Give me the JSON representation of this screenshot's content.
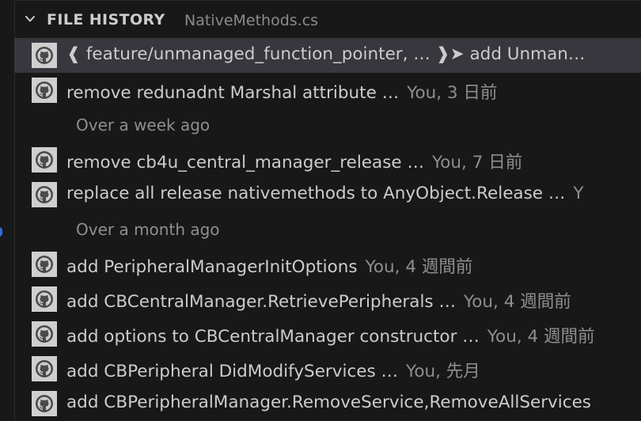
{
  "header": {
    "title": "FILE HISTORY",
    "file": "NativeMethods.cs"
  },
  "rows": [
    {
      "kind": "commit",
      "message": "❰ feature/unmanaged_function_pointer, … ❱➤  add Unman…",
      "description": "",
      "selected": true
    },
    {
      "kind": "commit",
      "message": "remove redunadnt Marshal attribute …",
      "description": "You, 3 日前"
    },
    {
      "kind": "group",
      "label": "Over a week ago"
    },
    {
      "kind": "commit",
      "message": "remove cb4u_central_manager_release …",
      "description": "You, 7 日前"
    },
    {
      "kind": "commit",
      "message": "replace all release nativemethods to AnyObject.Release …",
      "description": "Y"
    },
    {
      "kind": "group",
      "label": "Over a month ago"
    },
    {
      "kind": "commit",
      "message": "add PeripheralManagerInitOptions",
      "description": "You, 4 週間前"
    },
    {
      "kind": "commit",
      "message": "add CBCentralManager.RetrievePeripherals …",
      "description": "You, 4 週間前"
    },
    {
      "kind": "commit",
      "message": "add options to CBCentralManager constructor …",
      "description": "You, 4 週間前"
    },
    {
      "kind": "commit",
      "message": "add CBPeripheral DidModifyServices …",
      "description": "You, 先月"
    },
    {
      "kind": "commit",
      "message": "add CBPeripheralManager.RemoveService,RemoveAllServices",
      "description": ""
    }
  ],
  "icons": {
    "avatar": "github-icon",
    "chevron": "chevron-down-icon"
  },
  "colors": {
    "background": "#181818",
    "selected_row": "#37373d",
    "text": "#cccccc",
    "muted": "#8f8f8f",
    "scroll_indicator": "#2f6bd8"
  }
}
